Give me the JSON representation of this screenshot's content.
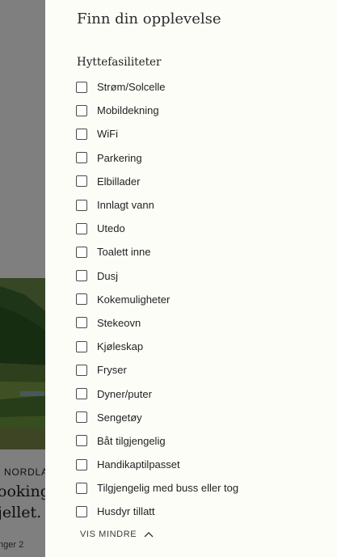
{
  "background": {
    "region": "NORDLAN",
    "heading_line1": "ookingle",
    "heading_line2": "jellet. V",
    "footer": "nger 2"
  },
  "drawer": {
    "title": "Finn din opplevelse",
    "section_title": "Hyttefasiliteter",
    "facilities": [
      "Strøm/Solcelle",
      "Mobildekning",
      "WiFi",
      "Parkering",
      "Elbillader",
      "Innlagt vann",
      "Utedo",
      "Toalett inne",
      "Dusj",
      "Kokemuligheter",
      "Stekeovn",
      "Kjøleskap",
      "Fryser",
      "Dyner/puter",
      "Sengetøy",
      "Båt tilgjengelig",
      "Handikaptilpasset",
      "Tilgjengelig med buss eller tog",
      "Husdyr tillatt"
    ],
    "show_less_label": "VIS MINDRE",
    "show_less_icon": "chevron-up-icon"
  }
}
